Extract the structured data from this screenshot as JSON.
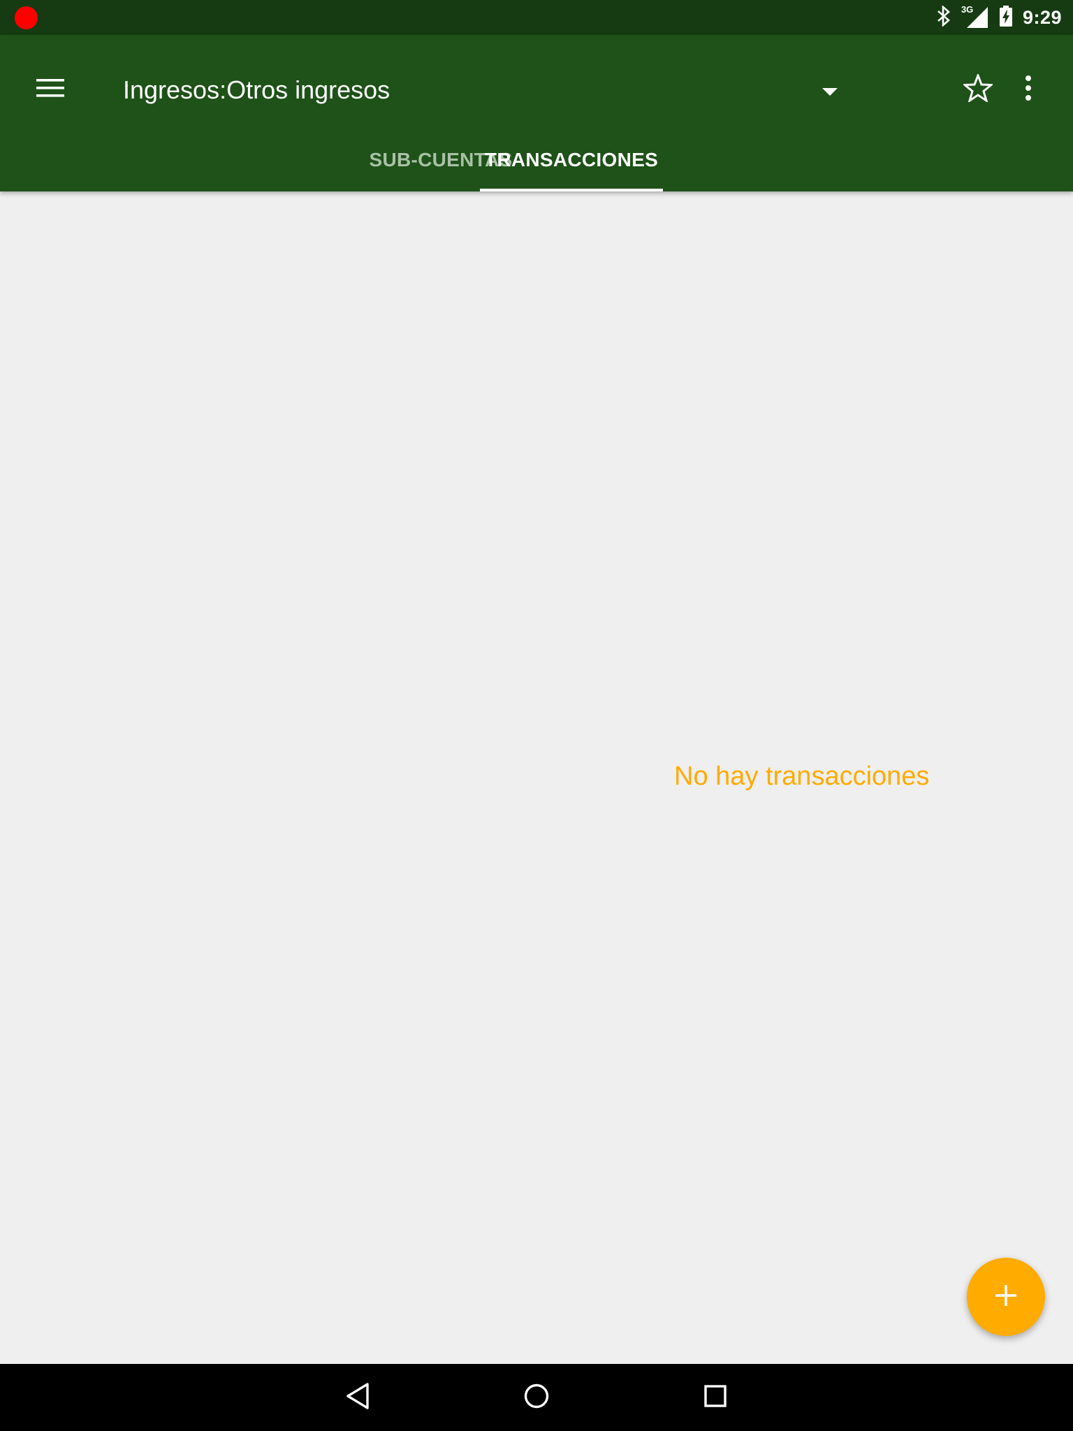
{
  "status_bar": {
    "time": "9:29",
    "network_label": "3G",
    "icons": [
      "recording-dot-icon",
      "bluetooth-icon",
      "signal-icon",
      "battery-charging-icon"
    ]
  },
  "app_bar": {
    "title": "Ingresos:Otros ingresos",
    "icons": [
      "menu-icon",
      "dropdown-arrow-icon",
      "star-outline-icon",
      "more-vert-icon"
    ],
    "tabs": [
      {
        "label": "SUB-CUENTAS",
        "selected": false
      },
      {
        "label": "TRANSACCIONES",
        "selected": true
      }
    ]
  },
  "content": {
    "empty_message": "No hay transacciones"
  },
  "fab": {
    "icon": "add-icon"
  },
  "nav_bar": {
    "icons": [
      "back-icon",
      "home-icon",
      "recents-icon"
    ]
  },
  "colors": {
    "status_bar": "#163b12",
    "app_bar": "#1e5218",
    "accent": "#ffab00",
    "background": "#efefef",
    "tab_inactive": "#a9c0a6"
  }
}
